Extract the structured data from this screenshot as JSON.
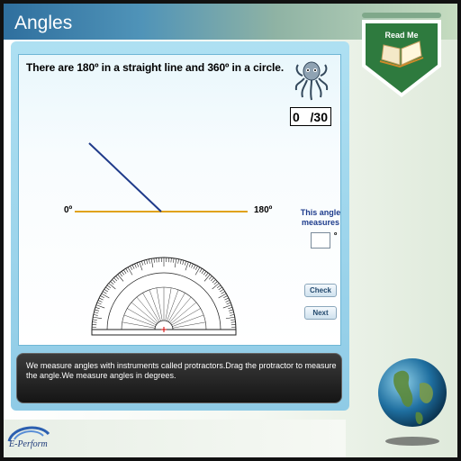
{
  "app": {
    "title": "Angles"
  },
  "question": {
    "text": "There are 180º in a straight line and 360º in a circle."
  },
  "score": {
    "current": "0",
    "total": "/30"
  },
  "line_labels": {
    "left": "0º",
    "right": "180º"
  },
  "answer": {
    "prompt": "This angle measures",
    "value": "",
    "unit": "º"
  },
  "buttons": {
    "check": "Check",
    "next": "Next"
  },
  "caption": {
    "text": "We measure angles with instruments called protractors.Drag the protractor to measure the angle.We measure angles in degrees."
  },
  "readme": {
    "label": "Read Me"
  },
  "logo": {
    "text": "E-Perform"
  },
  "colors": {
    "ray": "#1f3a8a",
    "baseline": "#e0a21a",
    "accent": "#2f6f9e",
    "readme_green": "#2e7a3e"
  },
  "icons": {
    "mascot": "octopus-icon",
    "readme": "open-book-icon",
    "globe": "globe-icon",
    "protractor": "protractor-icon"
  }
}
